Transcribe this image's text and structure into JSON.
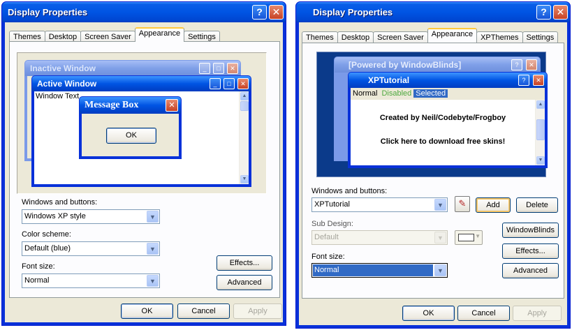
{
  "left": {
    "title": "Display Properties",
    "help_label": "?",
    "close_label": "✕",
    "tabs": [
      "Themes",
      "Desktop",
      "Screen Saver",
      "Appearance",
      "Settings"
    ],
    "preview": {
      "inactive_title": "Inactive Window",
      "active_title": "Active Window",
      "window_text": "Window Text",
      "message_title": "Message Box",
      "ok": "OK"
    },
    "windows_buttons_label": "Windows and buttons:",
    "windows_buttons_value": "Windows XP style",
    "color_scheme_label": "Color scheme:",
    "color_scheme_value": "Default (blue)",
    "font_size_label": "Font size:",
    "font_size_value": "Normal",
    "effects_label": "Effects...",
    "advanced_label": "Advanced",
    "ok_label": "OK",
    "cancel_label": "Cancel",
    "apply_label": "Apply"
  },
  "right": {
    "title": "Display Properties",
    "help_label": "?",
    "close_label": "✕",
    "tabs": [
      "Themes",
      "Desktop",
      "Screen Saver",
      "Appearance",
      "XPThemes",
      "Settings"
    ],
    "preview": {
      "back_title": "[Powered by WindowBlinds]",
      "front_title": "XPTutorial",
      "menu_normal": "Normal",
      "menu_disabled": "Disabled",
      "menu_selected": "Selected",
      "line1": "Created by Neil/Codebyte/Frogboy",
      "line2": "Click here to download free skins!"
    },
    "windows_buttons_label": "Windows and buttons:",
    "windows_buttons_value": "XPTutorial",
    "add_label": "Add",
    "delete_label": "Delete",
    "sub_design_label": "Sub Design:",
    "sub_design_value": "Default",
    "windowblinds_label": "WindowBlinds",
    "effects_label": "Effects...",
    "font_size_label": "Font size:",
    "font_size_value": "Normal",
    "advanced_label": "Advanced",
    "ok_label": "OK",
    "cancel_label": "Cancel",
    "apply_label": "Apply"
  },
  "colors": {
    "title_blue": "#0054e3",
    "client_bg": "#ece9d8",
    "desktop_blue": "#0b3a8a",
    "selected_highlight": "#316ac5",
    "disabled_menu_green": "#4ea93f"
  }
}
